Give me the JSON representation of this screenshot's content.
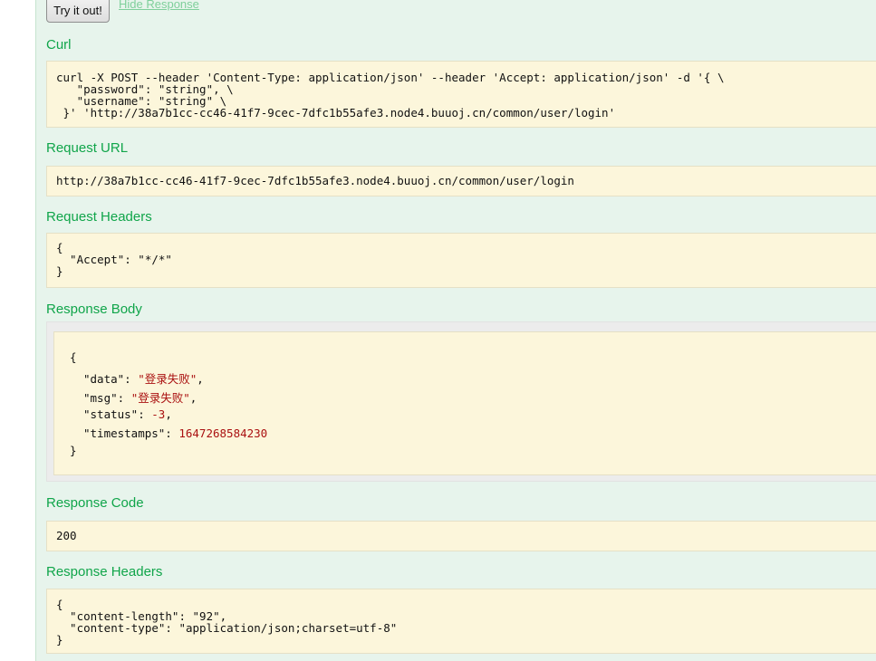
{
  "actions": {
    "try_label": "Try it out!",
    "hide_label": "Hide Response"
  },
  "curl": {
    "heading": "Curl",
    "command": "curl -X POST --header 'Content-Type: application/json' --header 'Accept: application/json' -d '{ \\\n   \"password\": \"string\", \\\n   \"username\": \"string\" \\\n }' 'http://38a7b1cc-cc46-41f7-9cec-7dfc1b55afe3.node4.buuoj.cn/common/user/login'"
  },
  "request_url": {
    "heading": "Request URL",
    "value": "http://38a7b1cc-cc46-41f7-9cec-7dfc1b55afe3.node4.buuoj.cn/common/user/login"
  },
  "request_headers": {
    "heading": "Request Headers",
    "value": "{\n  \"Accept\": \"*/*\"\n}"
  },
  "response_body": {
    "heading": "Response Body",
    "open": "{",
    "close": "}",
    "fields": [
      {
        "key": "\"data\": ",
        "value": "\"登录失败\"",
        "suffix": ","
      },
      {
        "key": "\"msg\": ",
        "value": "\"登录失败\"",
        "suffix": ","
      },
      {
        "key": "\"status\": ",
        "value": "-3",
        "suffix": ","
      },
      {
        "key": "\"timestamps\": ",
        "value": "1647268584230",
        "suffix": ""
      }
    ]
  },
  "response_code": {
    "heading": "Response Code",
    "value": "200"
  },
  "response_headers": {
    "heading": "Response Headers",
    "value": "{\n  \"content-length\": \"92\",\n  \"content-type\": \"application/json;charset=utf-8\"\n}"
  },
  "colors": {
    "panel_bg": "#e7f4ec",
    "heading": "#10a54a",
    "code_bg": "#fcf6db",
    "json_value": "#aa1111"
  }
}
